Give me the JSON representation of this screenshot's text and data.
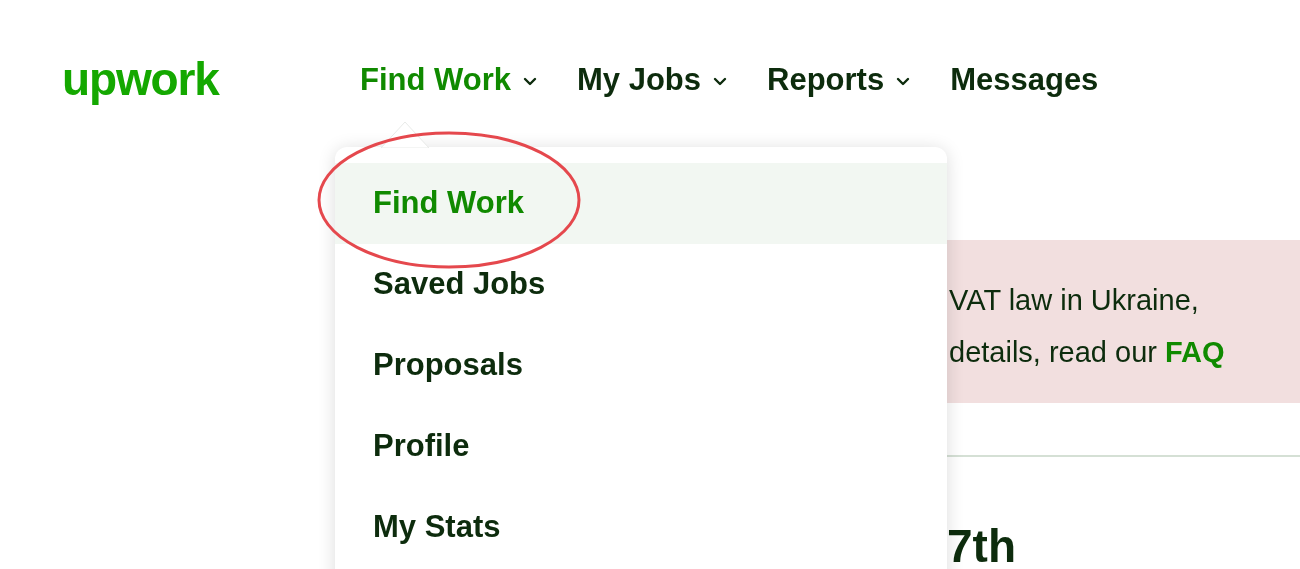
{
  "logo": "upwork",
  "nav": [
    {
      "label": "Find Work",
      "selected": true,
      "caret": true
    },
    {
      "label": "My Jobs",
      "selected": false,
      "caret": true
    },
    {
      "label": "Reports",
      "selected": false,
      "caret": true
    },
    {
      "label": "Messages",
      "selected": false,
      "caret": false
    }
  ],
  "menu": [
    {
      "label": "Find Work",
      "selected": true
    },
    {
      "label": "Saved Jobs",
      "selected": false
    },
    {
      "label": "Proposals",
      "selected": false
    },
    {
      "label": "Profile",
      "selected": false
    },
    {
      "label": "My Stats",
      "selected": false
    }
  ],
  "annotation": {
    "kind": "ellipse",
    "color": "#e5484d"
  },
  "banner": {
    "line_1": "VAT law in Ukraine,",
    "line_2": "details, read our",
    "link": "FAQ"
  },
  "heading": "7th"
}
